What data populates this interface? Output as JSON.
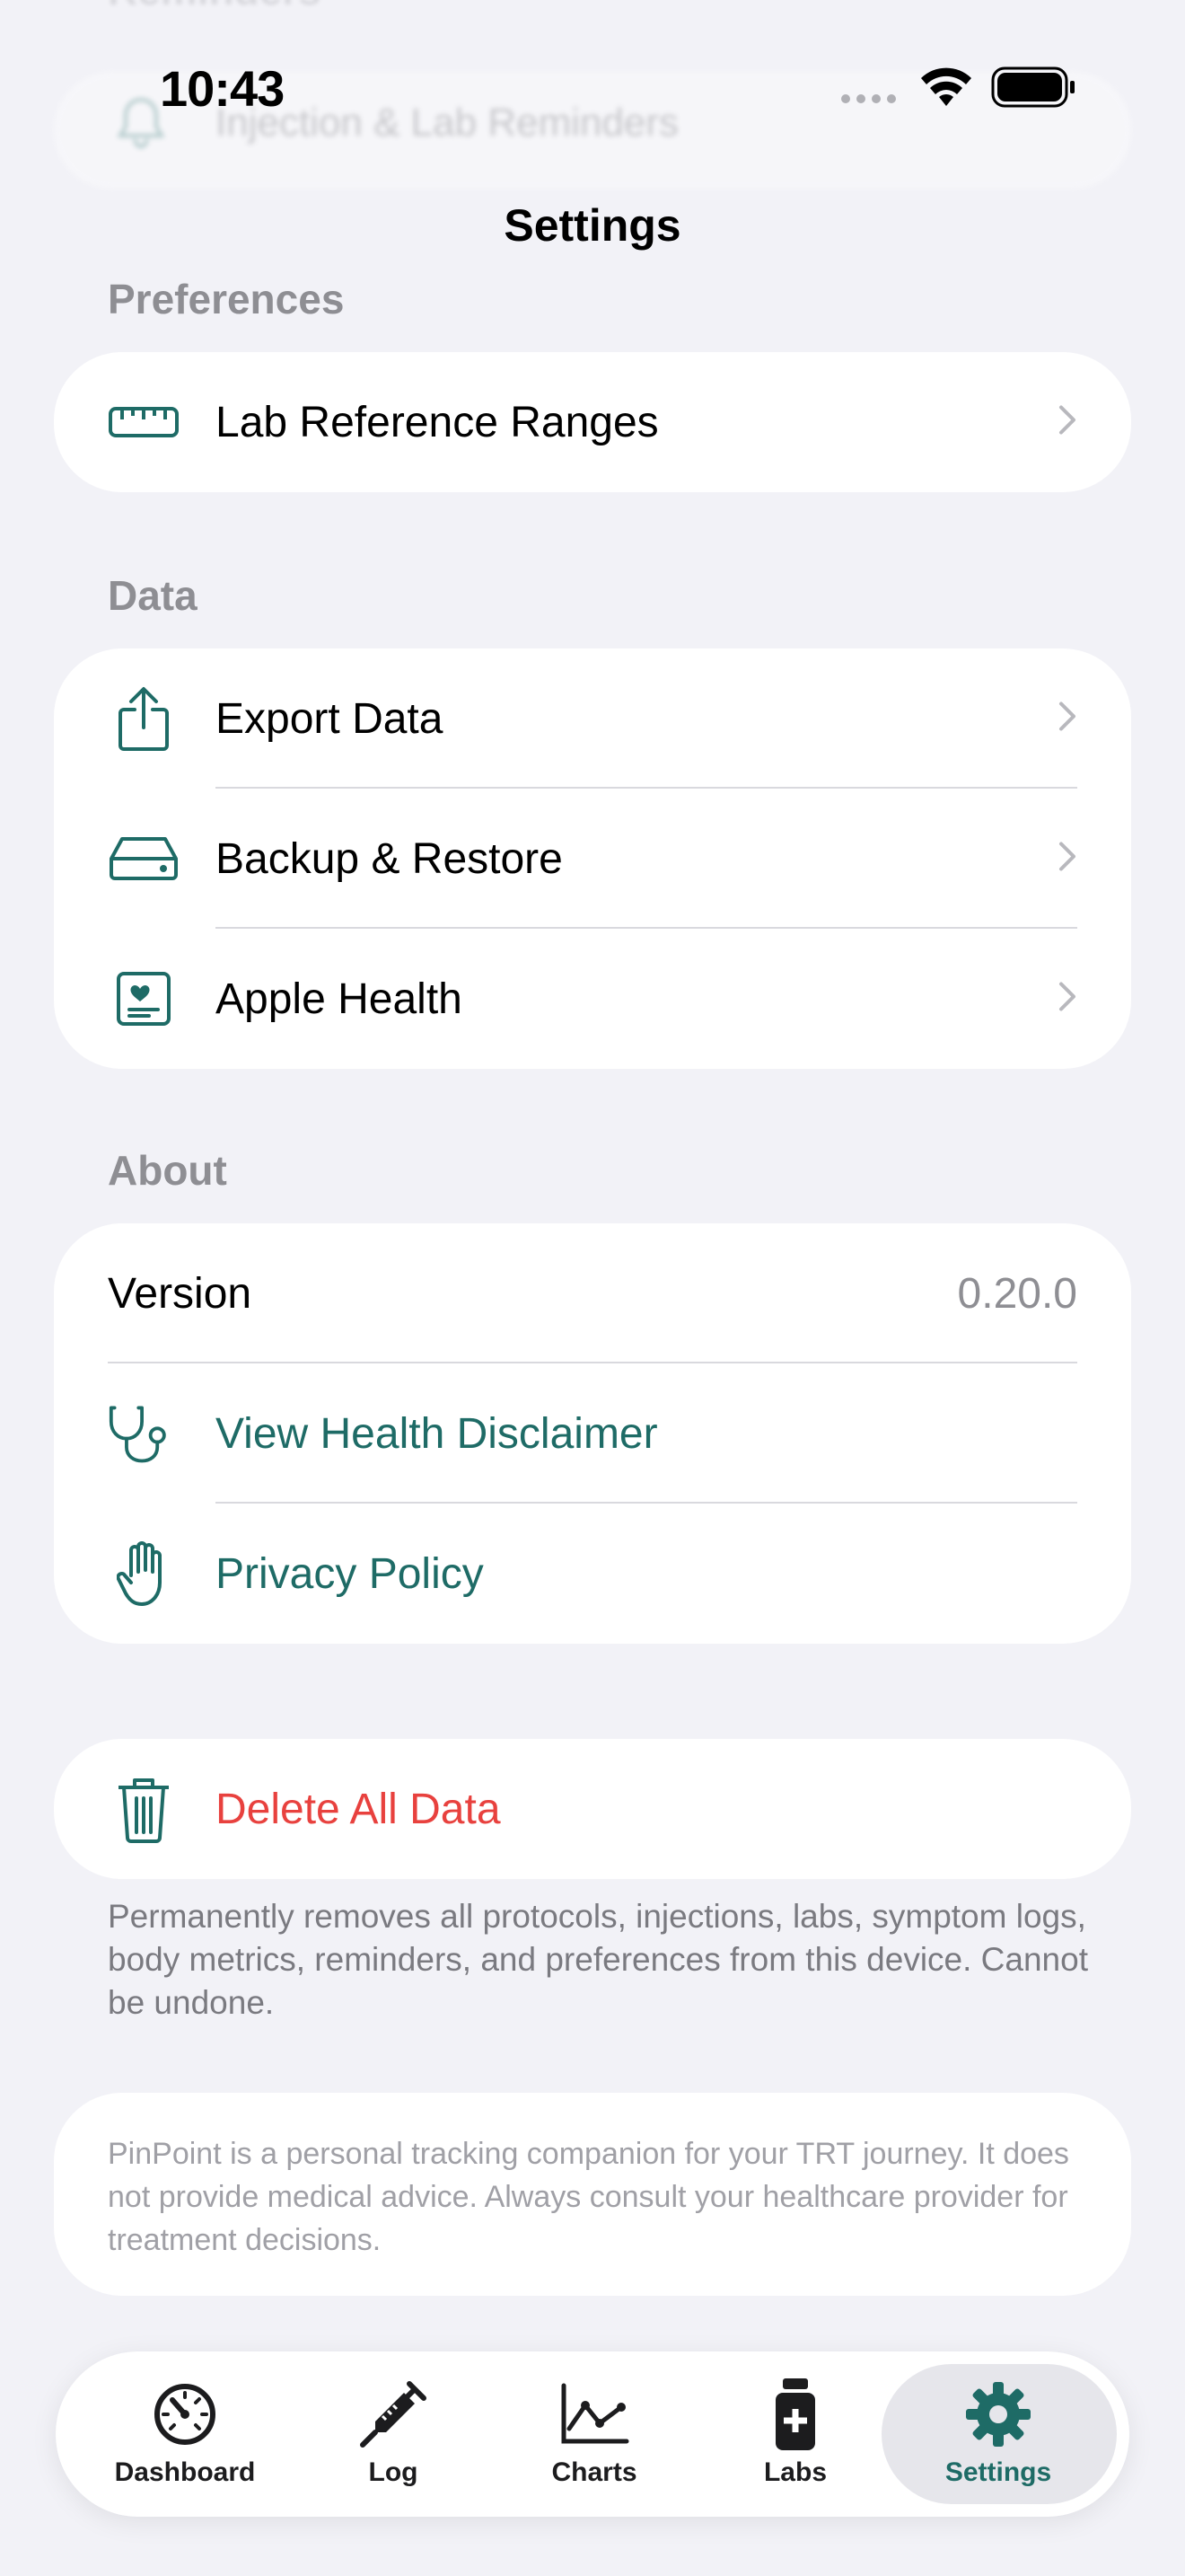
{
  "status_bar": {
    "time": "10:43"
  },
  "nav": {
    "title": "Settings"
  },
  "ghost": {
    "section": "Reminders",
    "row_label": "Injection & Lab Reminders"
  },
  "sections": {
    "preferences": {
      "header": "Preferences",
      "rows": [
        {
          "label": "Lab Reference Ranges",
          "icon": "ruler-icon"
        }
      ]
    },
    "data": {
      "header": "Data",
      "rows": [
        {
          "label": "Export Data",
          "icon": "share-icon"
        },
        {
          "label": "Backup & Restore",
          "icon": "drive-icon"
        },
        {
          "label": "Apple Health",
          "icon": "health-card-icon"
        }
      ]
    },
    "about": {
      "header": "About",
      "version_label": "Version",
      "version_value": "0.20.0",
      "rows": [
        {
          "label": "View Health Disclaimer",
          "icon": "stethoscope-icon"
        },
        {
          "label": "Privacy Policy",
          "icon": "hand-icon"
        }
      ]
    }
  },
  "delete": {
    "label": "Delete All Data",
    "icon": "trash-icon",
    "footnote": "Permanently removes all protocols, injections, labs, symptom logs, body metrics, reminders, and preferences from this device. Cannot be undone."
  },
  "disclaimer": "PinPoint is a personal tracking companion for your TRT journey. It does not provide medical advice. Always consult your healthcare provider for treatment decisions.",
  "tabs": [
    {
      "label": "Dashboard",
      "icon": "gauge-icon"
    },
    {
      "label": "Log",
      "icon": "syringe-icon"
    },
    {
      "label": "Charts",
      "icon": "line-chart-icon"
    },
    {
      "label": "Labs",
      "icon": "vial-icon"
    },
    {
      "label": "Settings",
      "icon": "gear-icon",
      "active": true
    }
  ],
  "colors": {
    "accent": "#1E6B66",
    "danger": "#E8413E",
    "background": "#F2F2F7",
    "secondary_text": "#8E8E93"
  }
}
